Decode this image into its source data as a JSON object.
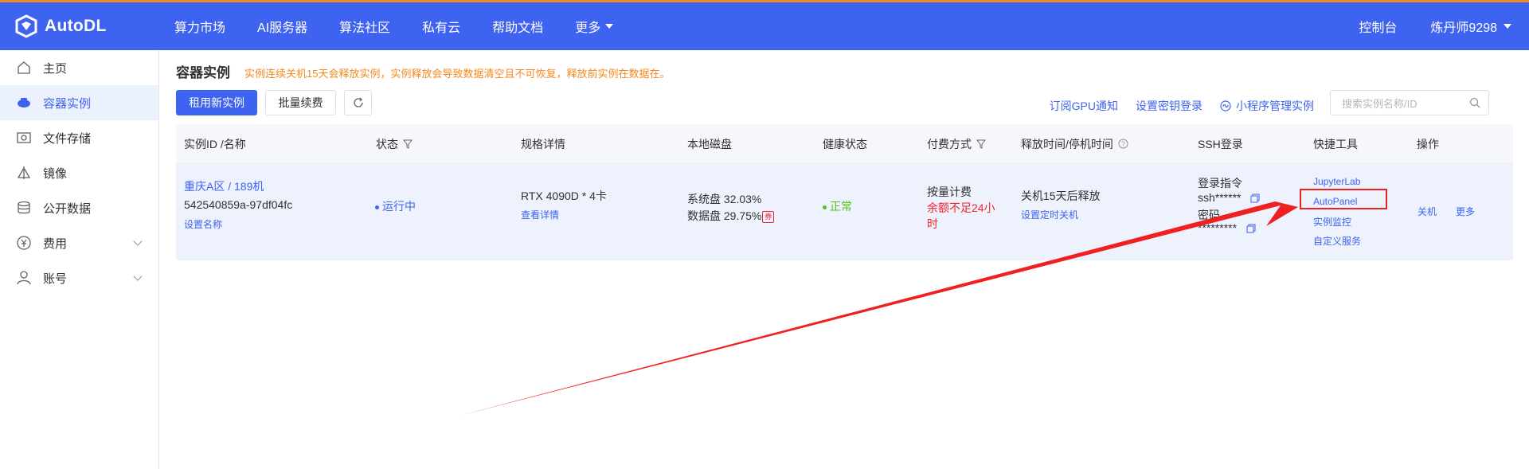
{
  "brand": {
    "logo_text": "AutoDL",
    "accent": "#3e63f0",
    "topline": "#f08a2c"
  },
  "nav": {
    "items": [
      "算力市场",
      "AI服务器",
      "算法社区",
      "私有云",
      "帮助文档",
      "更多"
    ],
    "console": "控制台",
    "user": "炼丹师9298"
  },
  "sidebar": {
    "items": [
      {
        "label": "主页",
        "icon": "home-icon"
      },
      {
        "label": "容器实例",
        "icon": "container-icon",
        "active": true
      },
      {
        "label": "文件存储",
        "icon": "storage-icon"
      },
      {
        "label": "镜像",
        "icon": "image-icon"
      },
      {
        "label": "公开数据",
        "icon": "database-icon"
      },
      {
        "label": "费用",
        "icon": "yen-icon",
        "expandable": true
      },
      {
        "label": "账号",
        "icon": "user-icon",
        "expandable": true
      }
    ]
  },
  "main": {
    "title": "容器实例",
    "notice": "实例连续关机15天会释放实例，实例释放会导致数据清空且不可恢复，释放前实例在数据在。",
    "buttons": {
      "rent": "租用新实例",
      "renew": "批量续费"
    },
    "links": {
      "gpu_notice": "订阅GPU通知",
      "ssh_key": "设置密钥登录",
      "miniprogram": "小程序管理实例"
    },
    "search_placeholder": "搜索实例名称/ID"
  },
  "table": {
    "headers": {
      "id": "实例ID /名称",
      "status": "状态",
      "spec": "规格详情",
      "disk": "本地磁盘",
      "health": "健康状态",
      "billing": "付费方式",
      "release": "释放时间/停机时间",
      "ssh": "SSH登录",
      "tools": "快捷工具",
      "ops": "操作"
    },
    "row": {
      "region": "重庆A区 / 189机",
      "instance_id": "542540859a-97df04fc",
      "set_name": "设置名称",
      "status": "运行中",
      "gpu": "RTX 4090D * 4卡",
      "view_detail": "查看详情",
      "system_disk": "系统盘 32.03%",
      "data_disk": "数据盘 29.75%",
      "coupon": "券",
      "health": "正常",
      "billing_type": "按量计费",
      "balance_warn_1": "余额不足24小",
      "balance_warn_2": "时",
      "release_text": "关机15天后释放",
      "set_timer": "设置定时关机",
      "ssh_cmd_label": "登录指令",
      "ssh_cmd": "ssh******",
      "pwd_label": "密码",
      "pwd": "*********",
      "tools": [
        "JupyterLab",
        "AutoPanel",
        "实例监控",
        "自定义服务"
      ],
      "op_shutdown": "关机",
      "op_more": "更多"
    }
  },
  "annotation": {
    "color": "#f02020"
  }
}
